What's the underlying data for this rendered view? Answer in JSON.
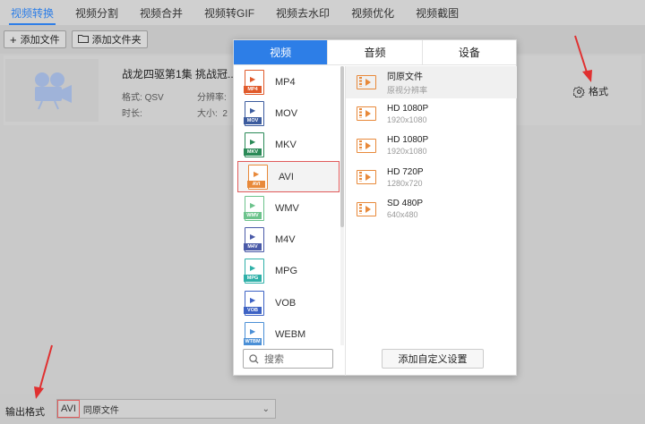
{
  "nav": {
    "tabs": [
      "视频转换",
      "视频分割",
      "视频合并",
      "视频转GIF",
      "视频去水印",
      "视频优化",
      "视频截图"
    ],
    "active_index": 0
  },
  "toolbar": {
    "add_file": "添加文件",
    "add_folder": "添加文件夹"
  },
  "file": {
    "name": "战龙四驱第1集 挑战冠...P...",
    "format_label": "格式:",
    "format_value": "QSV",
    "resolution_label": "分辨率:",
    "duration_label": "时长:",
    "size_label": "大小:",
    "size_value": "2",
    "format_button": "格式"
  },
  "popup": {
    "tabs": [
      "视频",
      "音频",
      "设备"
    ],
    "active_tab": 0,
    "formats": [
      {
        "label": "MP4",
        "tag": "MP4",
        "color": "#e05a2b"
      },
      {
        "label": "MOV",
        "tag": "MOV",
        "color": "#3b5b9e"
      },
      {
        "label": "MKV",
        "tag": "MKV",
        "color": "#2a8a57"
      },
      {
        "label": "AVI",
        "tag": "AVI",
        "color": "#e8893a"
      },
      {
        "label": "WMV",
        "tag": "WMV",
        "color": "#6cc38c"
      },
      {
        "label": "M4V",
        "tag": "M4V",
        "color": "#4a5aa8"
      },
      {
        "label": "MPG",
        "tag": "MPG",
        "color": "#2fb0a8"
      },
      {
        "label": "VOB",
        "tag": "VOB",
        "color": "#3d62c4"
      },
      {
        "label": "WEBM",
        "tag": "WTBM",
        "color": "#4a8fd6"
      }
    ],
    "selected_format": 3,
    "presets": [
      {
        "title": "同原文件",
        "sub": "原视分辨率"
      },
      {
        "title": "HD 1080P",
        "sub": "1920x1080"
      },
      {
        "title": "HD 1080P",
        "sub": "1920x1080"
      },
      {
        "title": "HD 720P",
        "sub": "1280x720"
      },
      {
        "title": "SD 480P",
        "sub": "640x480"
      }
    ],
    "active_preset": 0,
    "search_placeholder": "搜索",
    "add_custom": "添加自定义设置"
  },
  "bottom": {
    "output_label": "输出格式",
    "output_format": "AVI",
    "output_preset": "同原文件"
  },
  "colors": {
    "accent": "#2d7ee7",
    "highlight": "#e05a5a",
    "film": "#e8893a"
  }
}
